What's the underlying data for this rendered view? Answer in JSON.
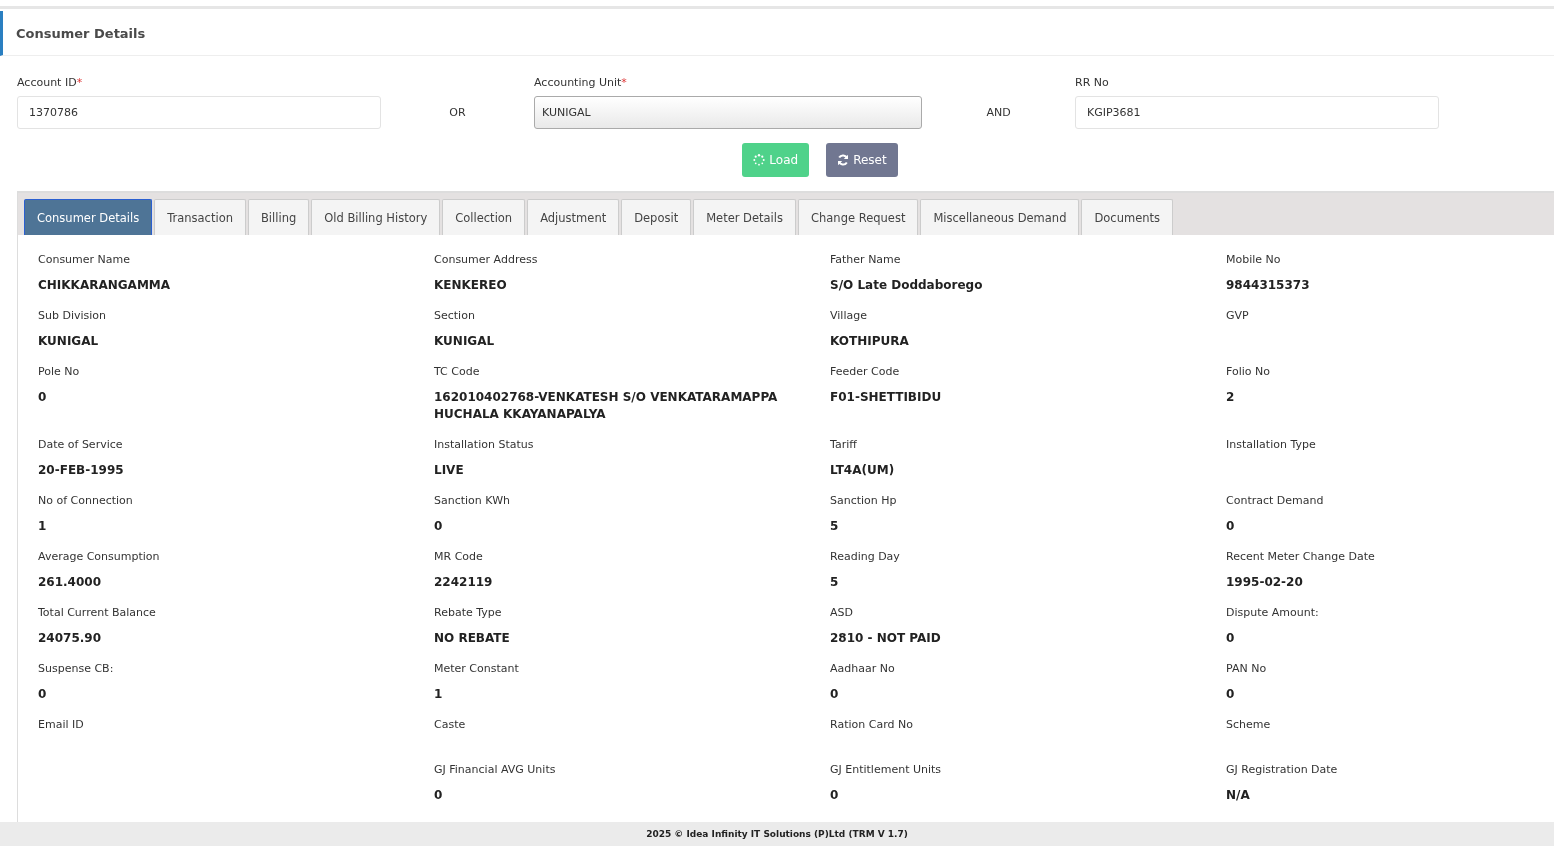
{
  "page_title": "Consumer Details",
  "search": {
    "fields": [
      {
        "kind": "input",
        "label": "Account ID",
        "required_mark": "*",
        "value": "1370786"
      },
      {
        "kind": "conjunction",
        "text": "OR"
      },
      {
        "kind": "select",
        "label": "Accounting Unit",
        "required_mark": "*",
        "value": "KUNIGAL"
      },
      {
        "kind": "conjunction",
        "text": "AND"
      },
      {
        "kind": "input",
        "label": "RR No",
        "value": "KGIP3681"
      }
    ],
    "buttons": [
      {
        "kind": "load",
        "label": "Load"
      },
      {
        "kind": "reset",
        "label": "Reset"
      }
    ]
  },
  "tabs": [
    {
      "label": "Consumer Details",
      "selected": true
    },
    {
      "label": "Transaction",
      "selected": false
    },
    {
      "label": "Billing",
      "selected": false
    },
    {
      "label": "Old Billing History",
      "selected": false
    },
    {
      "label": "Collection",
      "selected": false
    },
    {
      "label": "Adjustment",
      "selected": false
    },
    {
      "label": "Deposit",
      "selected": false
    },
    {
      "label": "Meter Details",
      "selected": false
    },
    {
      "label": "Change Request",
      "selected": false
    },
    {
      "label": "Miscellaneous Demand",
      "selected": false
    },
    {
      "label": "Documents",
      "selected": false
    }
  ],
  "details": [
    {
      "label": "Consumer Name",
      "value": "CHIKKARANGAMMA"
    },
    {
      "label": "Consumer Address",
      "value": "KENKEREO"
    },
    {
      "label": "Father Name",
      "value": "S/O Late Doddaborego"
    },
    {
      "label": "Mobile No",
      "value": "9844315373"
    },
    {
      "label": "Sub Division",
      "value": "KUNIGAL"
    },
    {
      "label": "Section",
      "value": "KUNIGAL"
    },
    {
      "label": "Village",
      "value": "KOTHIPURA"
    },
    {
      "label": "GVP"
    },
    {
      "label": "Pole No",
      "value": "0"
    },
    {
      "label": "TC Code",
      "value": "162010402768-VENKATESH S/O VENKATARAMAPPA HUCHALA KKAYANAPALYA"
    },
    {
      "label": "Feeder Code",
      "value": "F01-SHETTIBIDU"
    },
    {
      "label": "Folio No",
      "value": "2"
    },
    {
      "label": "Date of Service",
      "value": "20-FEB-1995"
    },
    {
      "label": "Installation Status",
      "value": "LIVE"
    },
    {
      "label": "Tariff",
      "value": "LT4A(UM)"
    },
    {
      "label": "Installation Type"
    },
    {
      "label": "No of Connection",
      "value": "1"
    },
    {
      "label": "Sanction KWh",
      "value": "0"
    },
    {
      "label": "Sanction Hp",
      "value": "5"
    },
    {
      "label": "Contract Demand",
      "value": "0"
    },
    {
      "label": "Average Consumption",
      "value": "261.4000"
    },
    {
      "label": "MR Code",
      "value": "2242119"
    },
    {
      "label": "Reading Day",
      "value": "5"
    },
    {
      "label": "Recent Meter Change Date",
      "value": "1995-02-20"
    },
    {
      "label": "Total Current Balance",
      "value": "24075.90"
    },
    {
      "label": "Rebate Type",
      "value": "NO REBATE"
    },
    {
      "label": "ASD",
      "value": "2810 - NOT PAID"
    },
    {
      "label": "Dispute Amount:",
      "value": "0"
    },
    {
      "label": "Suspense CB:",
      "value": "0"
    },
    {
      "label": "Meter Constant",
      "value": "1"
    },
    {
      "label": "Aadhaar No",
      "value": "0"
    },
    {
      "label": "PAN No",
      "value": "0"
    },
    {
      "label": "Email ID"
    },
    {
      "label": "Caste"
    },
    {
      "label": "Ration Card No"
    },
    {
      "label": "Scheme"
    },
    {
      "label": "GJ Financial AVG Units",
      "value": "0"
    },
    {
      "label": "GJ Entitlement Units",
      "value": "0"
    },
    {
      "label": "GJ Registration Date",
      "value": "N/A"
    }
  ],
  "footer": "2025 © Idea Infinity IT Solutions (P)Ltd (TRM V 1.7)"
}
